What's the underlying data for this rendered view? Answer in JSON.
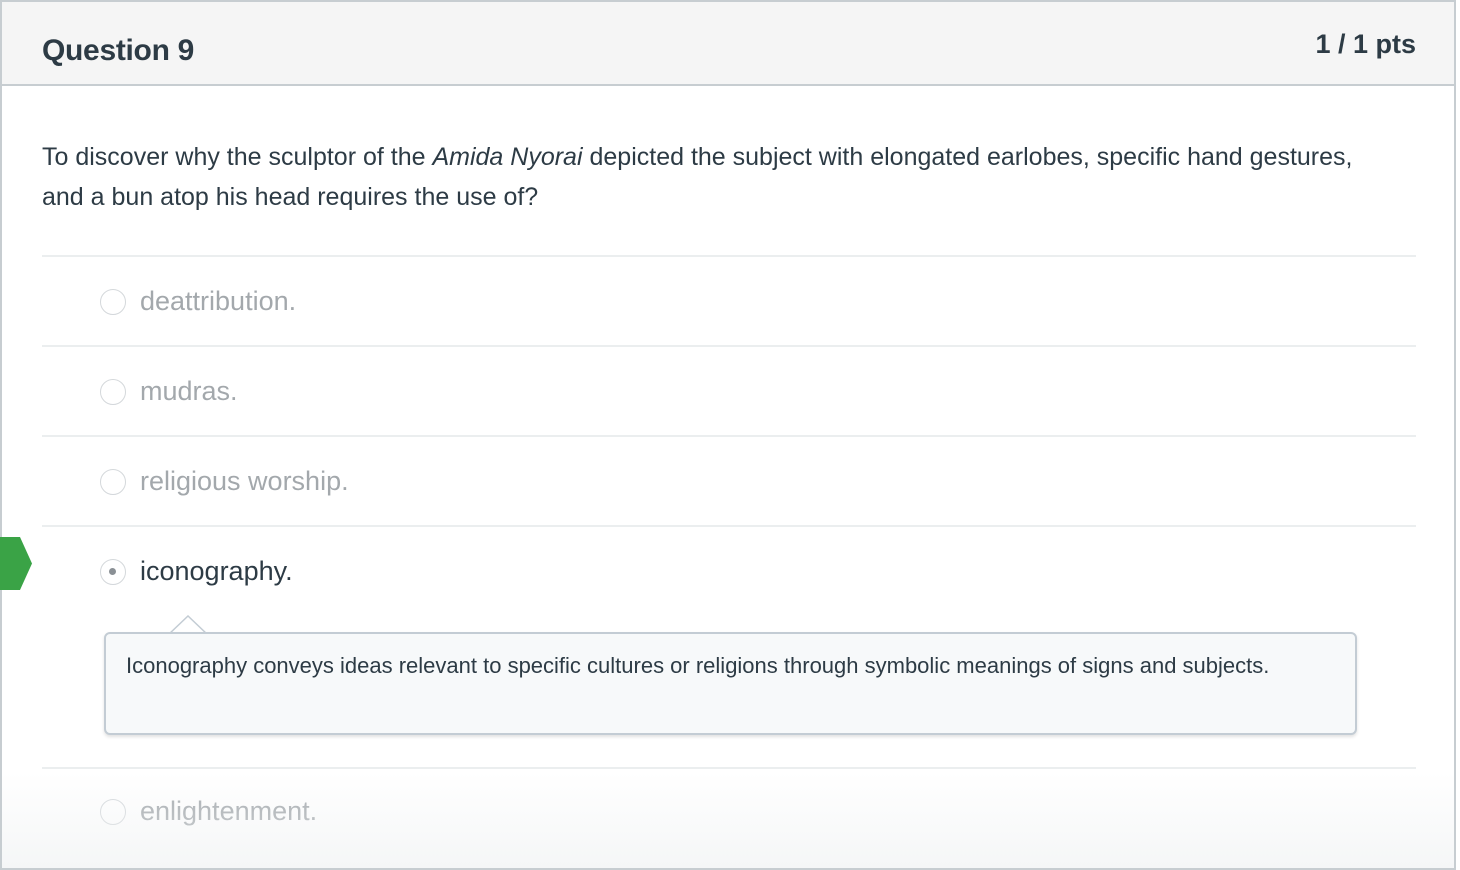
{
  "question": {
    "title": "Question 9",
    "points": "1 / 1 pts",
    "text_before": "To discover why the sculptor of the ",
    "text_italic": "Amida Nyorai",
    "text_after": " depicted the subject with elongated earlobes, specific hand gestures, and a bun atop his head requires the use of?"
  },
  "answers": [
    {
      "label": "deattribution.",
      "selected": false
    },
    {
      "label": "mudras.",
      "selected": false
    },
    {
      "label": "religious worship.",
      "selected": false
    },
    {
      "label": "iconography.",
      "selected": true
    },
    {
      "label": "enlightenment.",
      "selected": false
    }
  ],
  "feedback": {
    "text": "Iconography conveys ideas relevant to specific cultures or religions through symbolic meanings of signs and subjects."
  },
  "colors": {
    "correct_marker": "#3aa346",
    "text": "#2d3b45",
    "muted_text": "#a3a8ac",
    "header_bg": "#f5f5f5"
  },
  "icons": {
    "correct_marker": "correct-answer-arrow-icon",
    "radio": "radio-button-icon"
  }
}
